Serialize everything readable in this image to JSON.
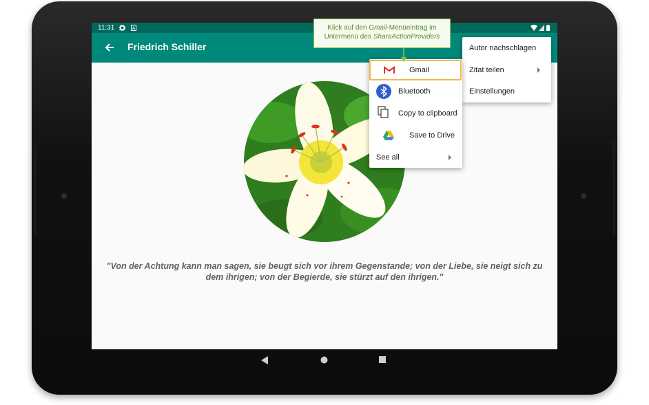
{
  "status_bar": {
    "time": "11:31"
  },
  "app_bar": {
    "title": "Friedrich Schiller"
  },
  "quote": "\"Von der Achtung kann man sagen, sie beugt sich vor ihrem Gegenstande; von der Liebe, sie neigt sich zu dem ihrigen; von der Begierde, sie stürzt auf den ihrigen.\"",
  "overflow_menu": {
    "items": [
      "Autor nachschlagen",
      "Zitat teilen",
      "Einstellungen"
    ]
  },
  "share_submenu": {
    "items": [
      {
        "label": "Gmail",
        "icon": "gmail-icon"
      },
      {
        "label": "Bluetooth",
        "icon": "bluetooth-icon"
      },
      {
        "label": "Copy to clipboard",
        "icon": "copy-icon"
      },
      {
        "label": "Save to Drive",
        "icon": "drive-icon"
      },
      {
        "label": "See all",
        "icon": "chevron-right-icon"
      }
    ]
  },
  "callout": {
    "line1_pre": "Klick auf den ",
    "line1_em": "Gmail",
    "line1_post": "-Menüeintrag im",
    "line2_pre": "Untermenü des ",
    "line2_em": "ShareActionProviders"
  },
  "colors": {
    "statusbar": "#00695c",
    "appbar": "#00897b",
    "callout_border": "#8bc34a",
    "highlight": "#f2b84b"
  }
}
